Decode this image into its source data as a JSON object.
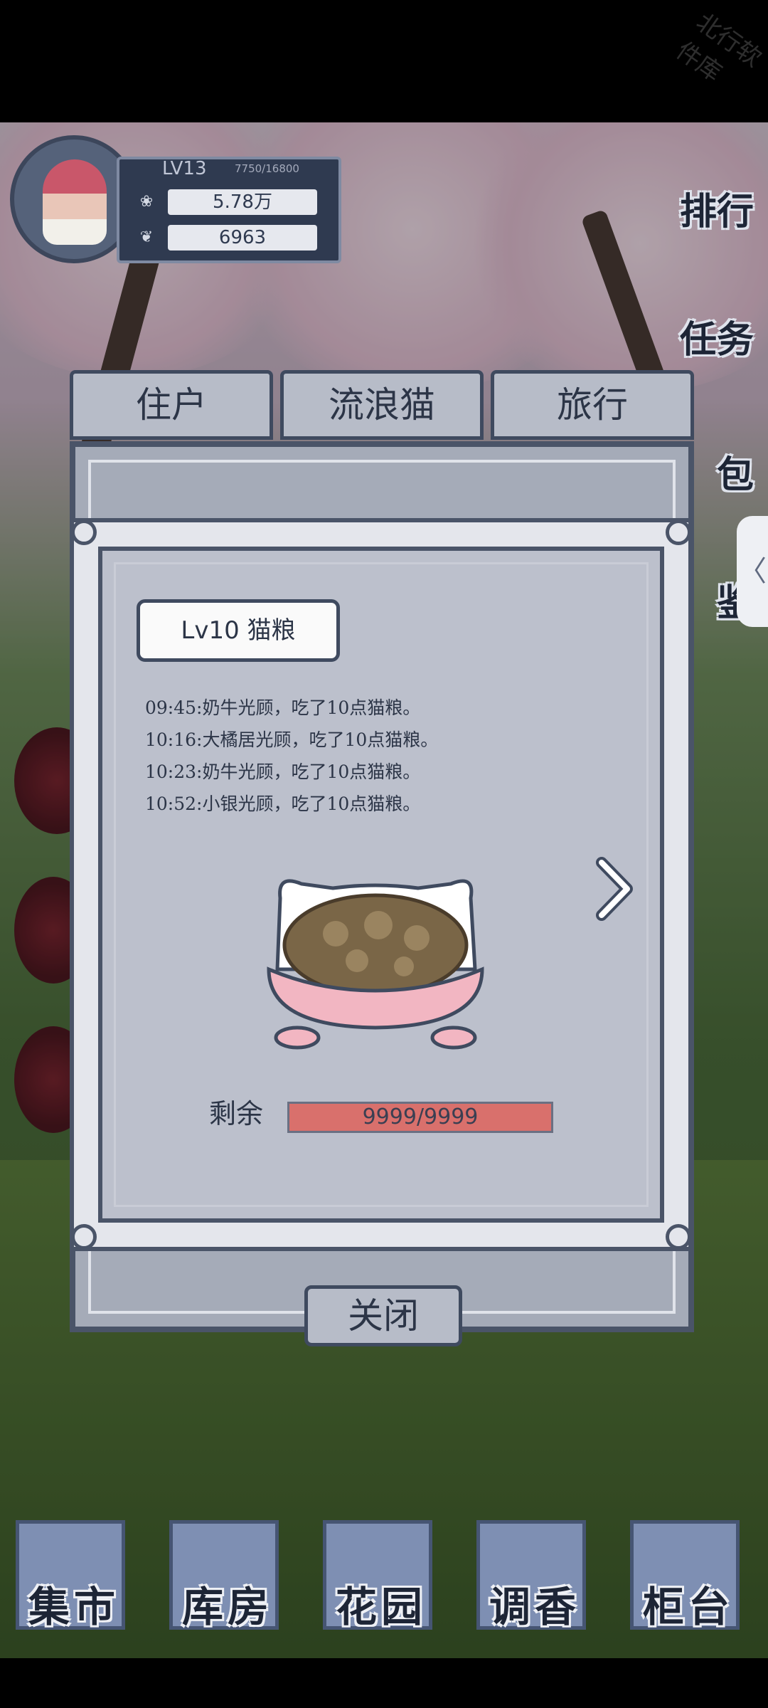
{
  "watermark": "北行软件库",
  "profile": {
    "level": "LV13",
    "exp": "7750/16800",
    "currency1": "5.78万",
    "currency2": "6963"
  },
  "side_menu": [
    "排行",
    "任务",
    "包",
    "鉴"
  ],
  "side_tab_arrow": "〈",
  "tabs": [
    "住户",
    "流浪猫",
    "旅行"
  ],
  "popup": {
    "title": "Lv10 猫粮",
    "log": [
      "09:45:奶牛光顾，吃了10点猫粮。",
      "10:16:大橘居光顾，吃了10点猫粮。",
      "10:23:奶牛光顾，吃了10点猫粮。",
      "10:52:小银光顾，吃了10点猫粮。"
    ],
    "remain_label": "剩余",
    "remain_value": "9999/9999",
    "remain_fraction": 1.0
  },
  "close_label": "关闭",
  "bottom_menu": [
    "集市",
    "库房",
    "花园",
    "调香",
    "柜台"
  ],
  "colors": {
    "panel_dark": "#4a5468",
    "panel_light": "#bcc0cc",
    "bar": "#d46a67"
  }
}
